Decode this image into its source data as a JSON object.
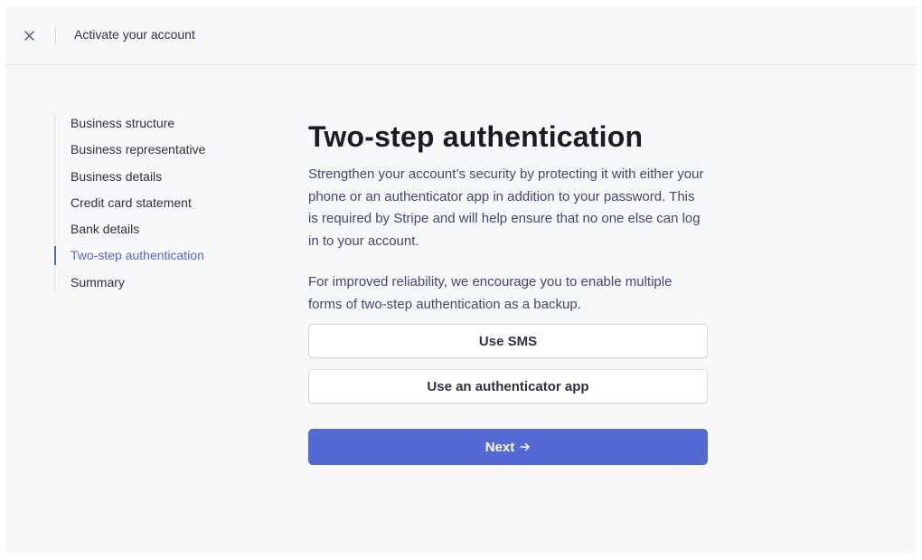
{
  "header": {
    "title": "Activate your account",
    "close_icon": "close-icon"
  },
  "sidebar": {
    "items": [
      {
        "label": "Business structure",
        "active": false
      },
      {
        "label": "Business representative",
        "active": false
      },
      {
        "label": "Business details",
        "active": false
      },
      {
        "label": "Credit card statement",
        "active": false
      },
      {
        "label": "Bank details",
        "active": false
      },
      {
        "label": "Two-step authentication",
        "active": true
      },
      {
        "label": "Summary",
        "active": false
      }
    ]
  },
  "main": {
    "title": "Two-step authentication",
    "description": "Strengthen your account’s security by protecting it with either your phone or an authenticator app in addition to your password. This is required by Stripe and will help ensure that no one else can log in to your account.",
    "note": "For improved reliability, we encourage you to enable multiple forms of two-step authentication as a backup.",
    "sms_button": "Use SMS",
    "app_button": "Use an authenticator app",
    "next_button": "Next",
    "next_icon": "arrow-right-icon"
  },
  "colors": {
    "accent": "#5469d4",
    "background": "#f7f8fa",
    "text": "#30313d"
  }
}
